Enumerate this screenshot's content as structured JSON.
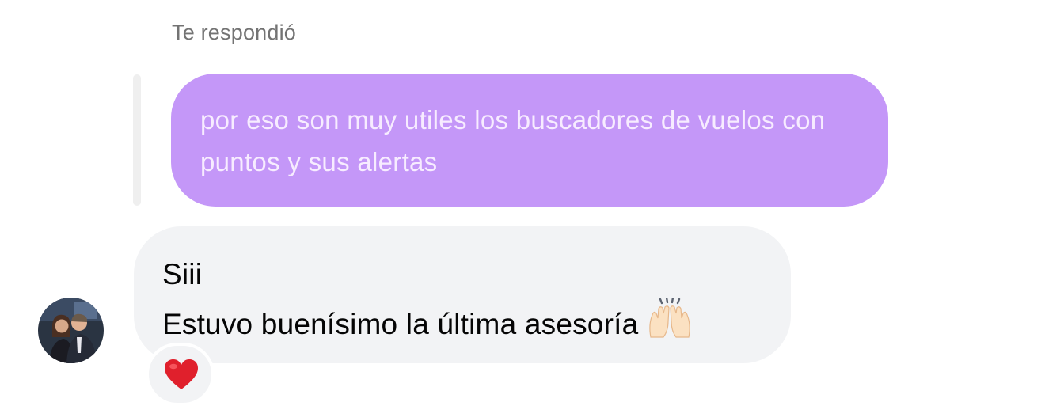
{
  "reply_header": {
    "label": "Te respondió"
  },
  "quoted_message": {
    "text": "por eso son muy utiles los buscadores de vuelos con puntos y sus alertas",
    "bubble_color": "#c497f8",
    "text_color": "#f7ecff"
  },
  "message": {
    "line1": "Siii",
    "line2": "Estuvo buenísimo la última asesoría",
    "emoji": "raising-hands-emoji",
    "bubble_color": "#f2f3f5"
  },
  "reaction": {
    "emoji": "red-heart-icon",
    "color": "#e0202c"
  },
  "sender": {
    "avatar": "avatar-photo"
  }
}
